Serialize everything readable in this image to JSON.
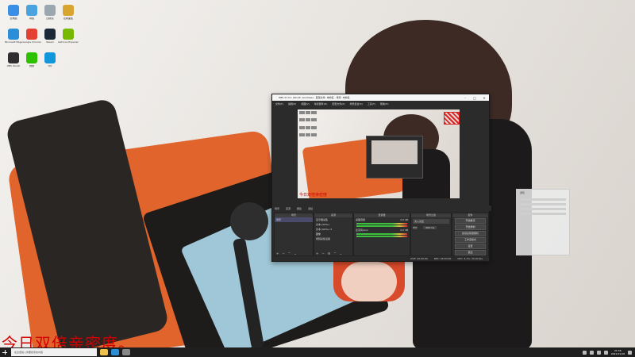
{
  "desktop": {
    "icons": [
      {
        "label": "此电脑",
        "color": "#3a8ee6",
        "icon": "computer-icon"
      },
      {
        "label": "网络",
        "color": "#4aa3df",
        "icon": "network-icon"
      },
      {
        "label": "回收站",
        "color": "#9aa7b1",
        "icon": "recycle-bin-icon"
      },
      {
        "label": "控制面板",
        "color": "#d9a531",
        "icon": "control-panel-icon"
      },
      {
        "label": "Microsoft Edge",
        "color": "#2c8ed6",
        "icon": "edge-icon"
      },
      {
        "label": "Google Chrome",
        "color": "#e34133",
        "icon": "chrome-icon"
      },
      {
        "label": "Steam",
        "color": "#1b2838",
        "icon": "steam-icon"
      },
      {
        "label": "GeForce Experience",
        "color": "#76b900",
        "icon": "nvidia-icon"
      },
      {
        "label": "OBS Studio",
        "color": "#302e31",
        "icon": "obs-icon"
      },
      {
        "label": "微信",
        "color": "#2dc100",
        "icon": "wechat-icon"
      },
      {
        "label": "QQ",
        "color": "#1296db",
        "icon": "qq-icon"
      }
    ]
  },
  "obs": {
    "title": "OBS 27.0.1 (64-bit, windows) - 配置文件: 未命名 - 场景: 未命名",
    "menu": [
      "文件(F)",
      "编辑(E)",
      "视图(V)",
      "停靠部件(D)",
      "配置文件(P)",
      "场景集合(S)",
      "工具(T)",
      "帮助(H)"
    ],
    "scene_bar": [
      "场景",
      "来源",
      "属性",
      "滤镜"
    ],
    "scenes_panel": {
      "title": "场景",
      "items": [
        "场景"
      ]
    },
    "sources_panel": {
      "title": "来源",
      "items": [
        "显示器采集",
        "文本 (GDI+)",
        "文本 (GDI+) 2",
        "图像",
        "视频采集设备"
      ]
    },
    "mixer_panel": {
      "title": "混音器",
      "channels": [
        "桌面音频",
        "麦克风/Aux"
      ],
      "levels": [
        "0.0 dB",
        "0.0 dB"
      ]
    },
    "transitions_panel": {
      "title": "场景过渡",
      "type": "淡入淡出",
      "duration_label": "时长",
      "duration": "300 ms"
    },
    "controls_panel": {
      "title": "控件",
      "buttons": [
        "开始推流",
        "开始录制",
        "启动虚拟摄像机",
        "工作室模式",
        "设置",
        "退出"
      ]
    },
    "status": {
      "live": "LIVE: 00:00:00",
      "rec": "REC: 00:00:00",
      "cpu": "CPU: 4.1%, 30.00 fps"
    },
    "preview_overlay": "今日双倍亲密度"
  },
  "popup": {
    "title": "通知"
  },
  "overlay_text": "今日双倍亲密度。",
  "taskbar": {
    "search_placeholder": "在这里输入你要搜索的内容",
    "apps": [
      {
        "icon": "file-explorer-icon",
        "color": "#f0c14b"
      },
      {
        "icon": "edge-icon",
        "color": "#2c8ed6"
      },
      {
        "icon": "obs-icon",
        "color": "#888888"
      }
    ],
    "time": "21:56",
    "date": "2021/11/18"
  }
}
